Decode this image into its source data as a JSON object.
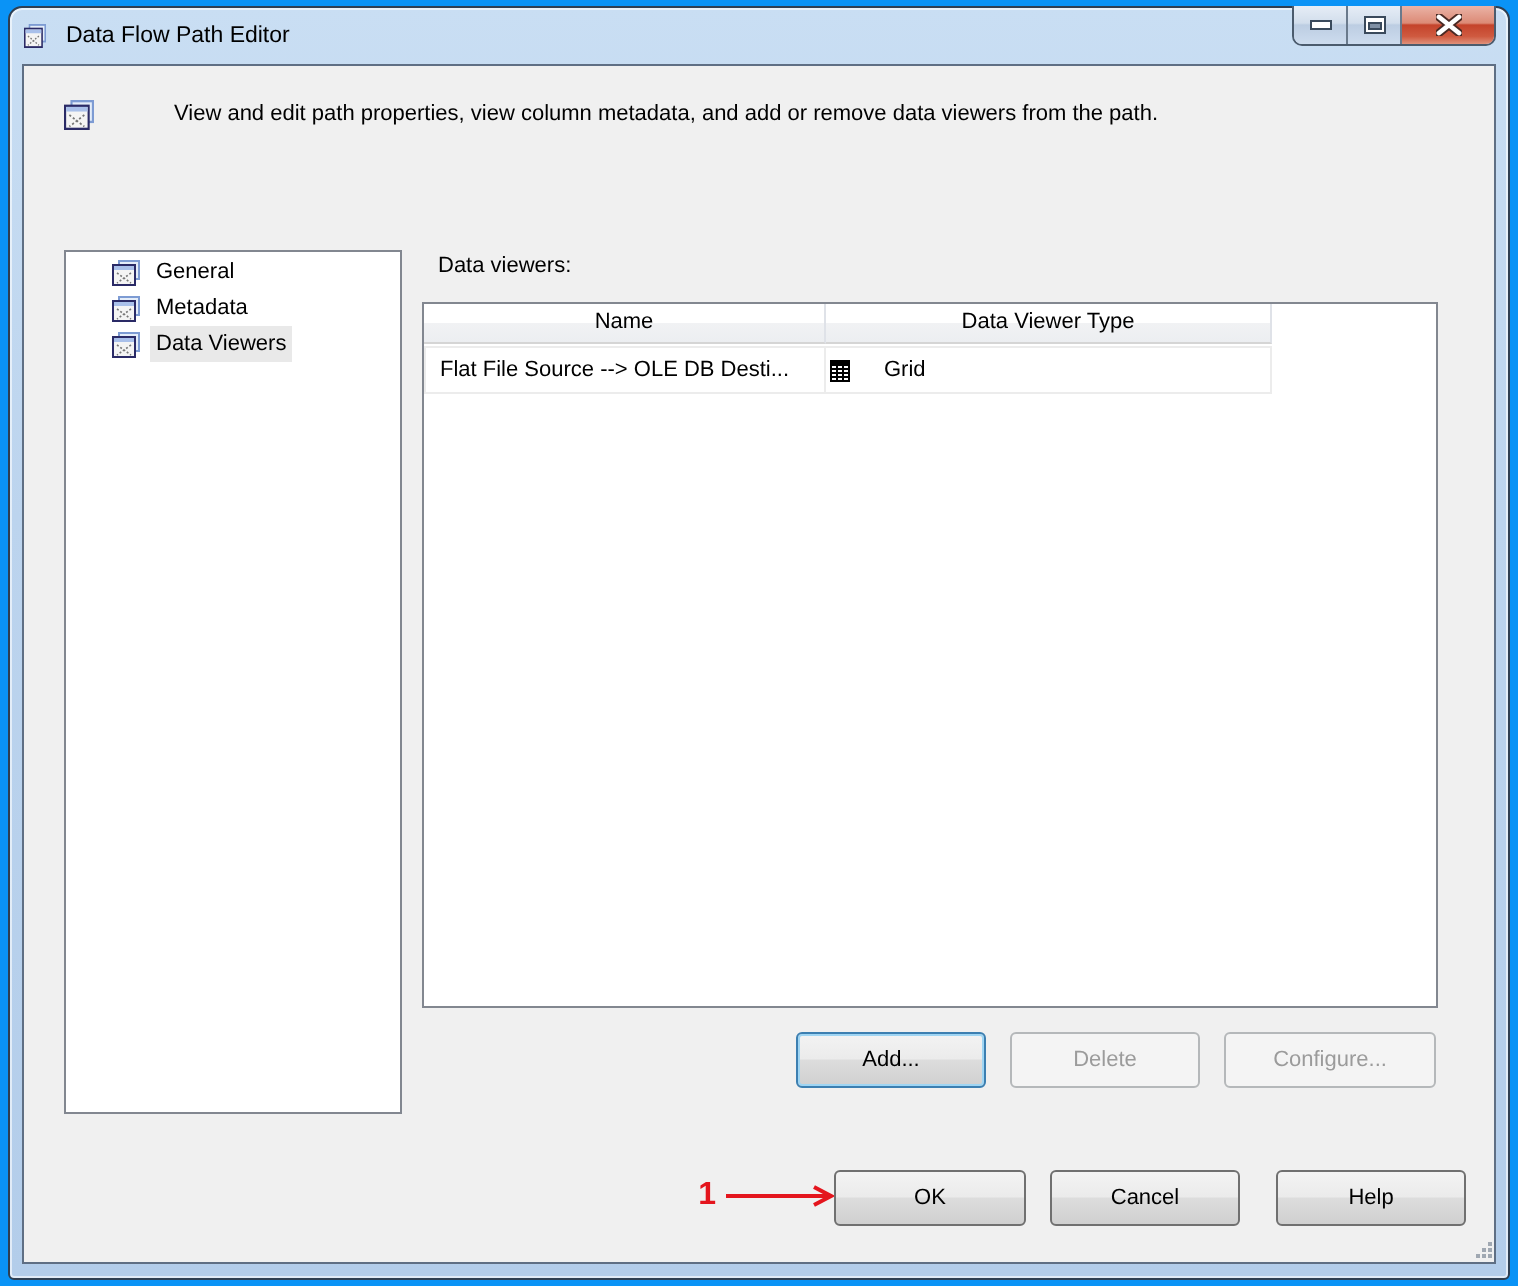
{
  "window": {
    "title": "Data Flow Path Editor"
  },
  "header": {
    "description": "View and edit path properties, view column metadata, and add or remove data viewers from the path."
  },
  "sidebar": {
    "items": [
      {
        "label": "General",
        "selected": false
      },
      {
        "label": "Metadata",
        "selected": false
      },
      {
        "label": "Data Viewers",
        "selected": true
      }
    ]
  },
  "data_viewers": {
    "label": "Data viewers:",
    "table": {
      "columns": [
        "Name",
        "Data Viewer Type"
      ],
      "rows": [
        {
          "name": "Flat File Source --> OLE DB Desti...",
          "type": "Grid"
        }
      ]
    },
    "buttons": [
      {
        "label": "Add...",
        "disabled": false,
        "focused": true
      },
      {
        "label": "Delete",
        "disabled": true,
        "focused": false
      },
      {
        "label": "Configure...",
        "disabled": true,
        "focused": false
      }
    ]
  },
  "dialog_buttons": [
    {
      "label": "OK"
    },
    {
      "label": "Cancel"
    },
    {
      "label": "Help"
    }
  ],
  "annotation": {
    "number": "1"
  }
}
